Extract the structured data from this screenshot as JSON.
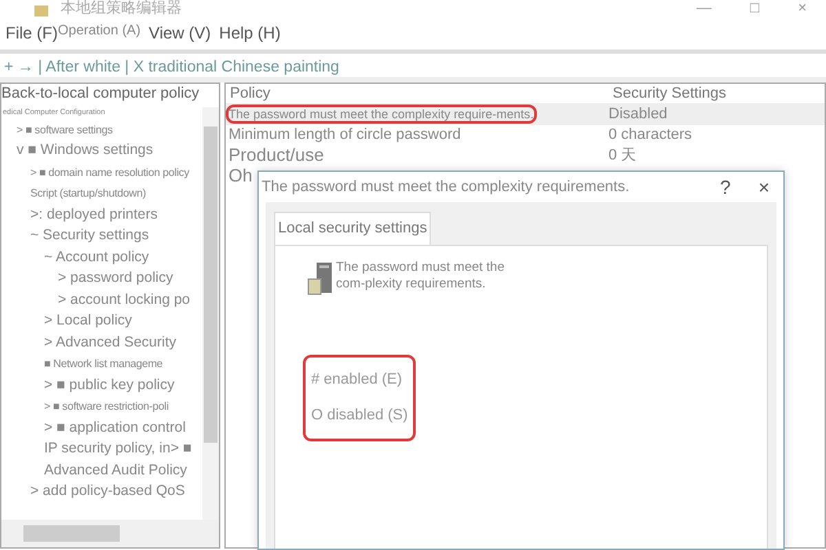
{
  "window": {
    "title": "本地组策略编辑器",
    "controls": [
      "—",
      "□",
      "×"
    ]
  },
  "menu": [
    "File (F)",
    "Operation (A)",
    "View (V)",
    "Help (H)"
  ],
  "toolbar": {
    "text": "+ → | After white | X traditional Chinese painting"
  },
  "tree": {
    "root": "Back-to-local computer policy",
    "items": [
      {
        "label": "edical Computer Configuration",
        "kind": "tiny",
        "children": [
          {
            "prefix": "> ■",
            "label": "software settings",
            "kind": "small"
          },
          {
            "prefix": "v ■",
            "label": "Windows settings",
            "kind": "normal",
            "children": [
              {
                "prefix": "> ■",
                "label": "domain name resolution policy",
                "kind": "small"
              },
              {
                "label": "Script (startup/shutdown)",
                "kind": "small"
              },
              {
                "prefix": ">:",
                "label": "deployed printers",
                "kind": "normal"
              },
              {
                "prefix": "~",
                "label": "Security settings",
                "kind": "normal",
                "children": [
                  {
                    "prefix": "~",
                    "label": "Account policy",
                    "kind": "normal",
                    "children": [
                      {
                        "prefix": ">",
                        "label": "password policy",
                        "kind": "normal"
                      },
                      {
                        "prefix": ">",
                        "label": "account locking po",
                        "kind": "normal"
                      }
                    ]
                  },
                  {
                    "prefix": ">",
                    "label": "Local policy",
                    "kind": "normal"
                  },
                  {
                    "prefix": ">",
                    "label": "Advanced Security",
                    "kind": "normal"
                  },
                  {
                    "prefix": "■",
                    "label": "Network list manageme",
                    "kind": "small"
                  },
                  {
                    "prefix": "> ■",
                    "label": "public key policy",
                    "kind": "normal"
                  },
                  {
                    "prefix": "> ■",
                    "label": "software restriction-poli",
                    "kind": "small"
                  },
                  {
                    "prefix": "> ■",
                    "label": "application control",
                    "kind": "normal"
                  },
                  {
                    "label": "IP security policy, in> ■",
                    "kind": "normal"
                  },
                  {
                    "label": "Advanced Audit Policy",
                    "kind": "normal"
                  }
                ]
              },
              {
                "prefix": ">",
                "label": "add policy-based QoS",
                "kind": "normal"
              }
            ]
          }
        ]
      }
    ]
  },
  "list": {
    "columns": [
      "Policy",
      "Security Settings"
    ],
    "rows": [
      {
        "policy": "The password must meet the complexity require-ments.",
        "setting": "Disabled",
        "selected": true,
        "highlighted": true
      },
      {
        "policy": "Minimum length of circle password",
        "setting": "0 characters",
        "selected": false,
        "highlighted": false
      },
      {
        "policy": "Product/use",
        "setting": "0 天",
        "selected": false,
        "highlighted": false
      },
      {
        "policy": "Oh",
        "selected": false,
        "highlighted": false
      }
    ]
  },
  "dialog": {
    "title": "The password must meet the complexity requirements.",
    "help": "?",
    "close": "×",
    "tabs": [
      {
        "label": "Local security settings",
        "selected": true
      }
    ],
    "description": "The password must meet the com-plexity requirements.",
    "options_highlighted": true,
    "options": [
      {
        "label": "# enabled (E)"
      },
      {
        "label": "O disabled (S)"
      }
    ]
  }
}
